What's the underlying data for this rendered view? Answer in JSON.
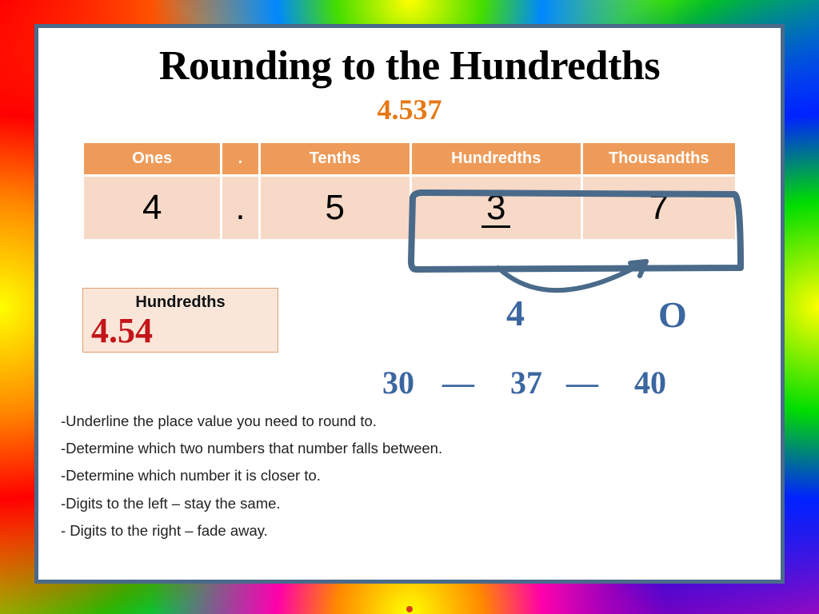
{
  "title": "Rounding to the Hundredths",
  "subtitle": "4.537",
  "table": {
    "headers": {
      "ones": "Ones",
      "dot": ".",
      "tenths": "Tenths",
      "hundredths": "Hundredths",
      "thousandths": "Thousandths"
    },
    "cells": {
      "ones": "4",
      "dot": ".",
      "tenths": "5",
      "hundredths": "3",
      "thousandths": "7"
    }
  },
  "answer": {
    "label": "Hundredths",
    "value": "4.54"
  },
  "hand": {
    "four": "4",
    "zero": "O",
    "thirty": "30",
    "dash1": "—",
    "thirtyseven": "37",
    "dash2": "—",
    "forty": "40"
  },
  "steps": {
    "s1": "-Underline the place value you need to round to.",
    "s2": "-Determine which two numbers that number falls between.",
    "s3": "-Determine which number it is closer to.",
    "s4": "-Digits to the left – stay the same.",
    "s5": "- Digits to the right – fade away."
  }
}
